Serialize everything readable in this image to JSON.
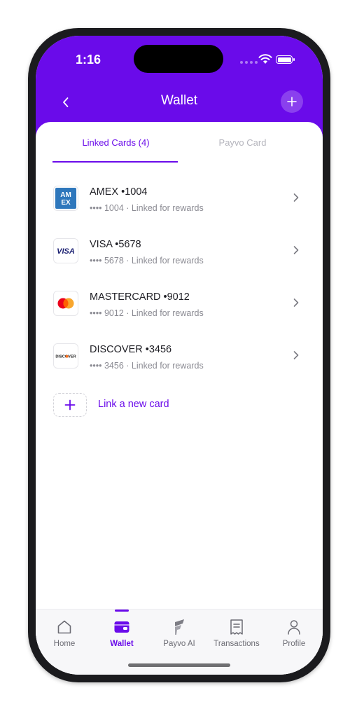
{
  "status": {
    "time": "1:16"
  },
  "header": {
    "title": "Wallet"
  },
  "tabs": [
    {
      "label": "Linked Cards (4)",
      "active": true
    },
    {
      "label": "Payvo Card",
      "active": false
    }
  ],
  "cards": [
    {
      "brand": "amex",
      "name": "AMEX •1004",
      "detail": "•••• 1004 · Linked for rewards"
    },
    {
      "brand": "visa",
      "name": "VISA •5678",
      "detail": "•••• 5678 · Linked for rewards"
    },
    {
      "brand": "mastercard",
      "name": "MASTERCARD •9012",
      "detail": "•••• 9012 · Linked for rewards"
    },
    {
      "brand": "discover",
      "name": "DISCOVER •3456",
      "detail": "•••• 3456 · Linked for rewards"
    }
  ],
  "logos": {
    "amex": "AM EX",
    "visa": "VISA",
    "discover": "DISCOVER"
  },
  "link_card": {
    "label": "Link a new card"
  },
  "tabbar": [
    {
      "label": "Home",
      "icon": "home-icon",
      "active": false
    },
    {
      "label": "Wallet",
      "icon": "wallet-icon",
      "active": true
    },
    {
      "label": "Payvo AI",
      "icon": "payvo-ai-icon",
      "active": false
    },
    {
      "label": "Transactions",
      "icon": "receipt-icon",
      "active": false
    },
    {
      "label": "Profile",
      "icon": "person-icon",
      "active": false
    }
  ],
  "colors": {
    "brand": "#6a0bea",
    "amex": "#2e77bc",
    "visa": "#1a1f71",
    "mc_red": "#eb001b",
    "mc_orange": "#f79e1b",
    "discover_orange": "#f76f20"
  }
}
